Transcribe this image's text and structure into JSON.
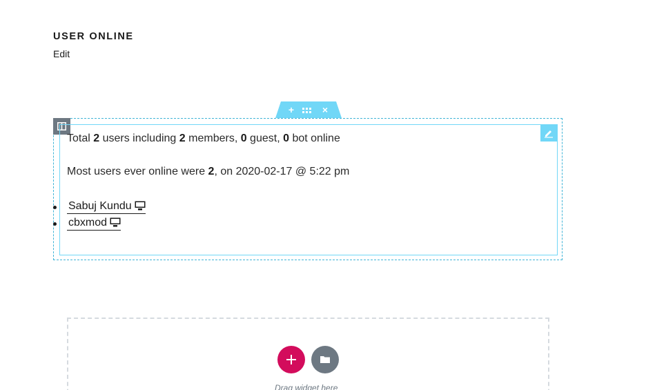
{
  "widget": {
    "title": "USER ONLINE",
    "edit_label": "Edit"
  },
  "section_handle": {
    "add_label": "+",
    "close_label": "×"
  },
  "online": {
    "line1": {
      "prefix": "Total ",
      "total_users": "2",
      "mid1": " users including ",
      "members": "2",
      "mid2": " members, ",
      "guests": "0",
      "mid3": " guest, ",
      "bots": "0",
      "suffix": " bot online"
    },
    "line2": {
      "prefix": "Most users ever online were ",
      "max_users": "2",
      "suffix": ", on 2020-02-17 @ 5:22 pm"
    },
    "users": [
      {
        "name": "Sabuj Kundu",
        "device_icon": "desktop-icon"
      },
      {
        "name": "cbxmod",
        "device_icon": "desktop-icon"
      }
    ]
  },
  "drop_zone": {
    "hint": "Drag widget here"
  },
  "colors": {
    "editor_blue": "#71d7f7",
    "editor_outline": "#3fb4d7",
    "handle_gray": "#6d7882",
    "add_pink": "#d30c5c"
  }
}
